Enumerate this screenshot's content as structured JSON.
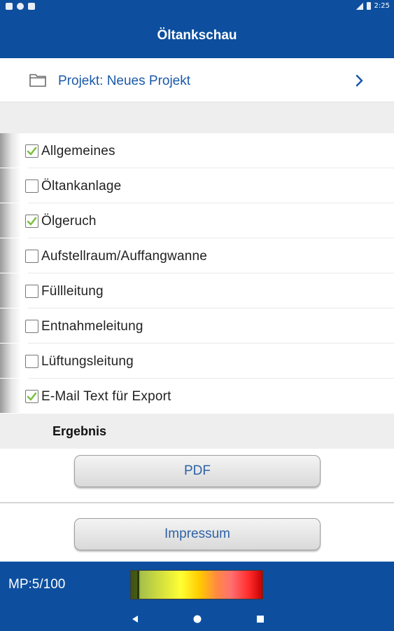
{
  "status_bar": {
    "time": "2:25",
    "left_icons": [
      "notification-icon",
      "sync-icon",
      "sd-card-icon"
    ],
    "right_icons": [
      "signal-icon",
      "battery-icon"
    ]
  },
  "app_bar": {
    "title": "Öltankschau"
  },
  "project": {
    "label": "Projekt: Neues Projekt",
    "icon": "folder-icon",
    "chevron": "chevron-right-icon"
  },
  "checklist": [
    {
      "label": "Allgemeines",
      "checked": true
    },
    {
      "label": "Öltankanlage",
      "checked": false
    },
    {
      "label": "Ölgeruch",
      "checked": true
    },
    {
      "label": "Aufstellraum/Auffangwanne",
      "checked": false
    },
    {
      "label": "Füllleitung",
      "checked": false
    },
    {
      "label": "Entnahmeleitung",
      "checked": false
    },
    {
      "label": "Lüftungsleitung",
      "checked": false
    },
    {
      "label": "E-Mail Text für Export",
      "checked": true
    }
  ],
  "result": {
    "label": "Ergebnis",
    "pdf_button": "PDF",
    "impressum_button": "Impressum"
  },
  "mp": {
    "label": "MP:5/100",
    "value": 5,
    "max": 100
  },
  "nav": {
    "back": "back-icon",
    "home": "home-icon",
    "recents": "recents-icon"
  },
  "colors": {
    "primary": "#0d4f9e",
    "link": "#1a5aa8",
    "check": "#7bc142",
    "band": "#eeeeee"
  }
}
